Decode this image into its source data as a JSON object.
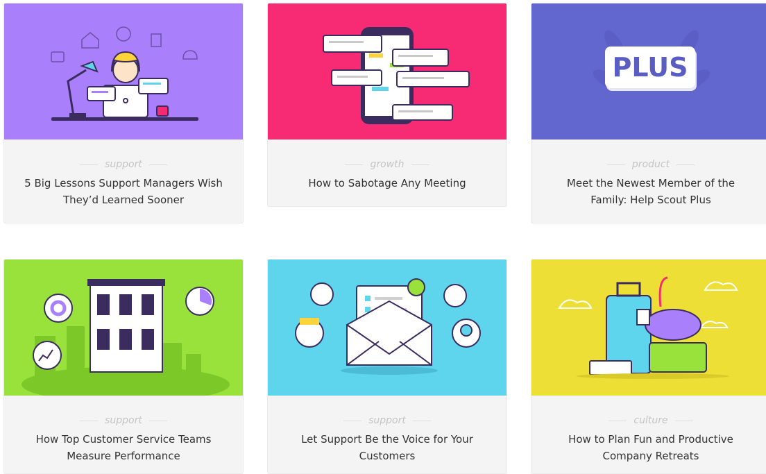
{
  "cards": [
    {
      "category": "support",
      "title": "5 Big Lessons Support Managers Wish They’d Learned Sooner",
      "color": "#a97ffb"
    },
    {
      "category": "growth",
      "title": "How to Sabotage Any Meeting",
      "color": "#f72b73"
    },
    {
      "category": "product",
      "title": "Meet the Newest Member of the Family: Help Scout Plus",
      "color": "#6266cf",
      "badge": "PLUS"
    },
    {
      "category": "support",
      "title": "How Top Customer Service Teams Measure Performance",
      "color": "#99e23b"
    },
    {
      "category": "support",
      "title": "Let Support Be the Voice for Your Customers",
      "color": "#5fd4ed"
    },
    {
      "category": "culture",
      "title": "How to Plan Fun and Productive Company Retreats",
      "color": "#eedf36"
    }
  ]
}
